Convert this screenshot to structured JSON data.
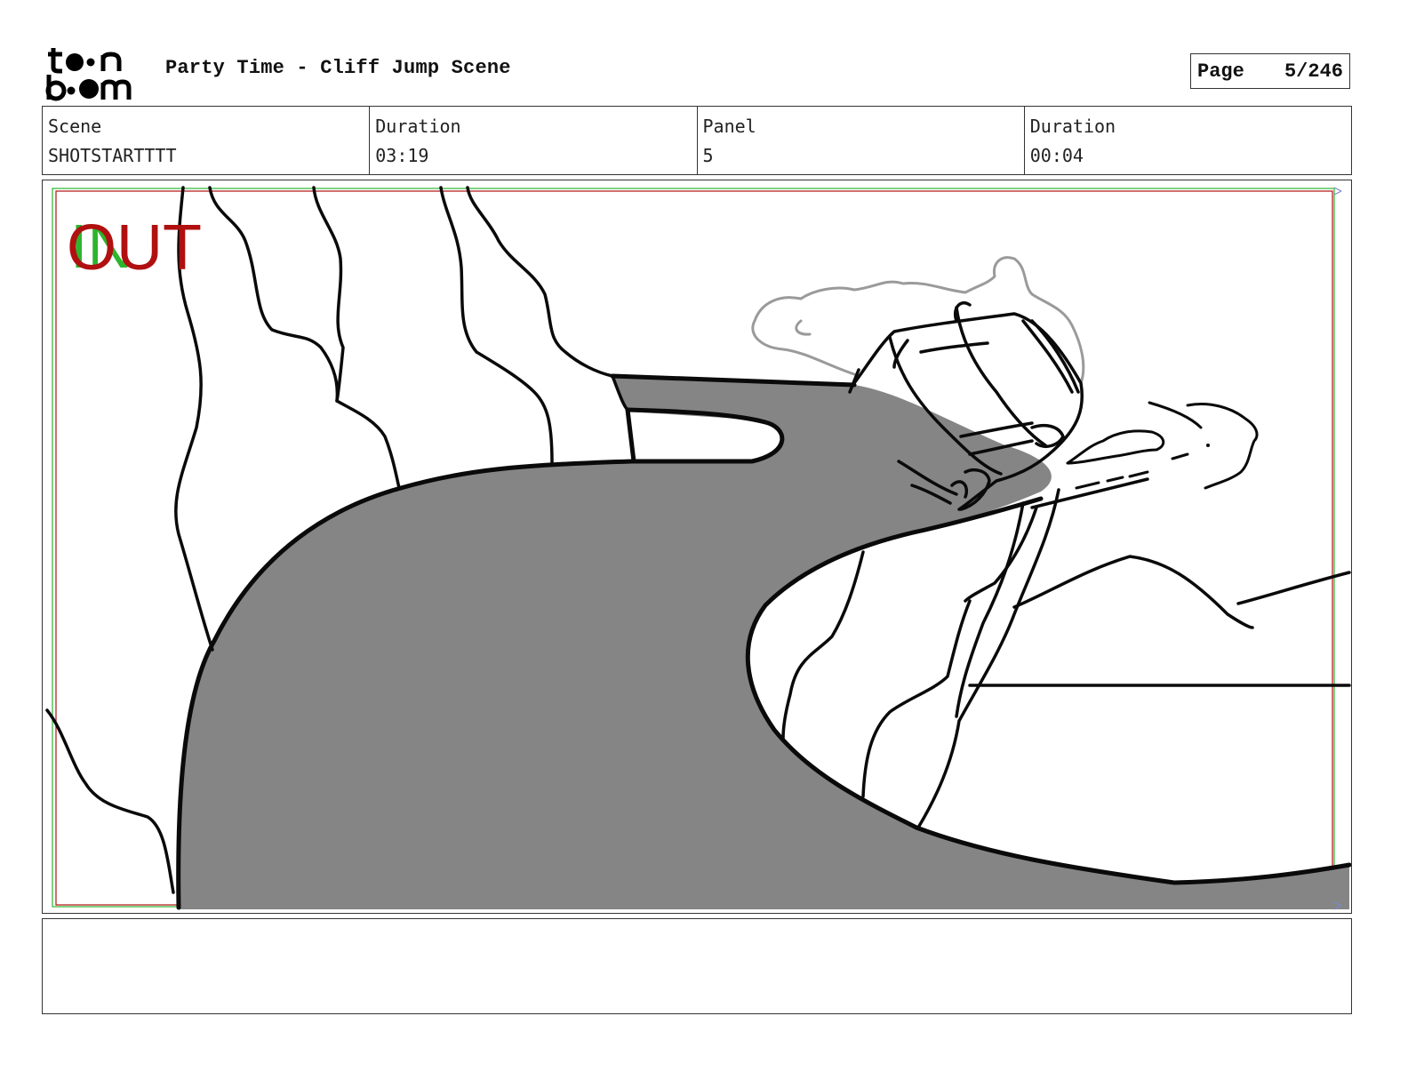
{
  "header": {
    "logo_text": "toon boom",
    "title": "Party Time - Cliff Jump Scene",
    "page_label": "Page",
    "page_value": "5/246"
  },
  "info": [
    {
      "label": "Scene",
      "value": "SHOTSTARTTTT"
    },
    {
      "label": "Duration",
      "value": "03:19"
    },
    {
      "label": "Panel",
      "value": "5"
    },
    {
      "label": "Duration",
      "value": "00:04"
    }
  ],
  "panel": {
    "in_marker": "IN",
    "out_marker": "OUT",
    "colors": {
      "in": "#2db52d",
      "out": "#b01010",
      "road": "#858585",
      "ink": "#0a0a0a",
      "dust": "#9a9a9a"
    }
  },
  "notes": {
    "text": ""
  }
}
